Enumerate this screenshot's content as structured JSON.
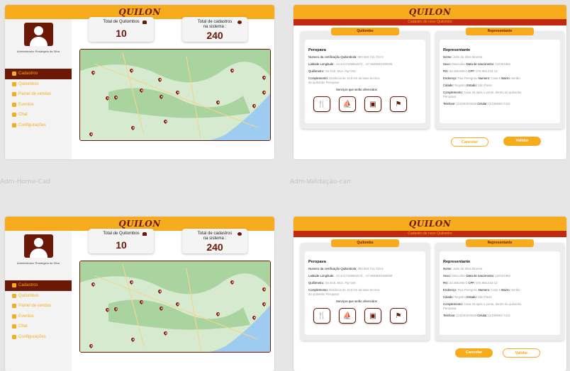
{
  "app": {
    "title": "QUILON"
  },
  "home": {
    "admin_name": "Administrador Rosângela da Silva",
    "nav": [
      {
        "label": "Cadastros",
        "icon": "list-icon"
      },
      {
        "label": "Quilombos",
        "icon": "home-icon"
      },
      {
        "label": "Painel de vendas",
        "icon": "gear-icon"
      },
      {
        "label": "Eventos",
        "icon": "calendar-icon"
      },
      {
        "label": "Chat",
        "icon": "chat-icon"
      },
      {
        "label": "Configurações",
        "icon": "settings-icon"
      }
    ],
    "card_quilombos": {
      "label": "Total de Quilombos",
      "value": "10"
    },
    "card_cadastros": {
      "label": "Total de cadastros na sistema :",
      "value": "240"
    }
  },
  "validation": {
    "bar_text": "Cadastro de novo Quilombo",
    "quilombo": {
      "title": "Quilombo",
      "name": "Peropava",
      "fields": [
        {
          "k": "Numero da certificação Quilombola:",
          "v": "383.593.741.723-5"
        },
        {
          "k": "Latitude Longitude:",
          "v": "-24.4417109564573 , -47.8849648180008"
        },
        {
          "k": "Quilômetro:",
          "v": "Via Estr. Mun. Pgr-025"
        },
        {
          "k": "Complemento:",
          "v": "Distância de 10,8 km da base tecnica"
        },
        {
          "k": "",
          "v": "do quilombo Peropava"
        }
      ],
      "services_label": "Serviços que serão oferecidos",
      "services": [
        "fork-knife-icon",
        "canoe-icon",
        "jar-icon",
        "flag-icon"
      ]
    },
    "representante": {
      "title": "Representante",
      "name": "Representante",
      "fields": [
        {
          "k": "Nome:",
          "v": "João da Silva Moreira"
        },
        {
          "k": "Sexo:",
          "v": "Masculino"
        },
        {
          "k": "Data de nascimento:",
          "v": "12/04/1966"
        },
        {
          "k": "RG:",
          "v": "33.456.965-1"
        },
        {
          "k": "CPF:",
          "v": "678.965.432-12"
        },
        {
          "k": "Endereço:",
          "v": "Rua Peregrino"
        },
        {
          "k": "Numero:",
          "v": "Casa 5"
        },
        {
          "k": "Bairro:",
          "v": "Sertão"
        },
        {
          "k": "Cidade:",
          "v": "Registro"
        },
        {
          "k": "Estado:",
          "v": "São Paulo"
        },
        {
          "k": "Complemento:",
          "v": "Casa 26 após o ponte, dentro do quilombo"
        },
        {
          "k": "",
          "v": "Peropava"
        },
        {
          "k": "Telefone:",
          "v": "(13)3819-9638"
        },
        {
          "k": "Celular:",
          "v": "(13)99693-7412"
        }
      ]
    },
    "cancel_label": "Cancelar",
    "validate_label": "Validar"
  },
  "labels": {
    "home": "Adm-Home-Cad",
    "validation": "Adm-Validação-can"
  },
  "colors": {
    "accent": "#f7ac1d",
    "brand": "#6b1806",
    "bar": "#c12a10"
  }
}
